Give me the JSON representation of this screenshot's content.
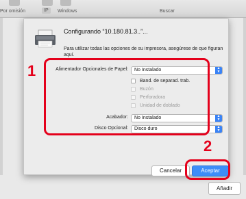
{
  "toolbar": {
    "tabs": [
      {
        "label": "Por omisión",
        "icon": "default-printers-icon"
      },
      {
        "label": "IP",
        "icon": "ip-globe-icon"
      },
      {
        "label": "Windows",
        "icon": "windows-icon"
      },
      {
        "label": "Buscar",
        "icon": "search-field"
      }
    ]
  },
  "background": {
    "add_button_label": "Añadir"
  },
  "dialog": {
    "title": "Configurando “10.180.81.3..”...",
    "description": "Para utilizar todas las opciones de su impresora, asegúrese de que figuran aquí.",
    "options": {
      "paper_feeder": {
        "label": "Alimentador Opcionales de Papel:",
        "value": "No Instalado"
      },
      "checkboxes": [
        {
          "label": "Band. de separad. trab.",
          "checked": false,
          "enabled": true
        },
        {
          "label": "Buzón",
          "checked": false,
          "enabled": false
        },
        {
          "label": "Perforadora",
          "checked": false,
          "enabled": false
        },
        {
          "label": "Unidad de doblado",
          "checked": false,
          "enabled": false
        }
      ],
      "finisher": {
        "label": "Acabador:",
        "value": "No Instalado"
      },
      "optional_disk": {
        "label": "Disco Opcional:",
        "value": "Disco duro"
      }
    },
    "cancel_label": "Cancelar",
    "accept_label": "Aceptar"
  },
  "annotations": [
    {
      "number": "1",
      "color": "#e4001b"
    },
    {
      "number": "2",
      "color": "#e4001b"
    }
  ],
  "colors": {
    "accent": "#3d8df7",
    "annotation": "#e4001b"
  }
}
